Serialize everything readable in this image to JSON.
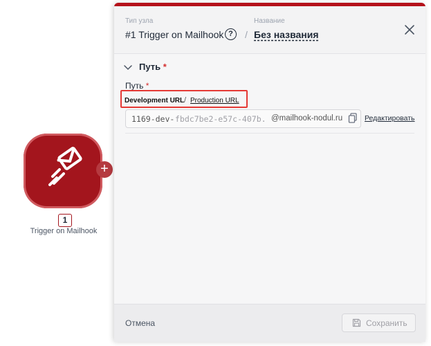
{
  "canvas": {
    "node": {
      "icon": "mailhook-envelope-icon",
      "color": "#a3151d",
      "number": "1",
      "label": "Trigger on Mailhook",
      "add_icon": "+"
    }
  },
  "panel": {
    "accent_color": "#b5121b",
    "header": {
      "type_label": "Тип узла",
      "type_value": "#1 Trigger on Mailhook",
      "help_icon": "?",
      "separator": "/",
      "name_label": "Название",
      "name_value": "Без названия",
      "close_icon": "close-icon"
    },
    "section": {
      "title": "Путь",
      "required_mark": "*"
    },
    "path_field": {
      "label": "Путь",
      "required_mark": "*",
      "tabs": {
        "dev": "Development URL",
        "separator": "/",
        "prod": "Production URL"
      },
      "url_prefix": "1169-dev-",
      "url_id": "fbdc7be2-e57c-407b...",
      "url_domain": "@mailhook-nodul.ru",
      "edit_label": "Редактировать"
    },
    "footer": {
      "cancel_label": "Отмена",
      "save_label": "Сохранить"
    }
  }
}
